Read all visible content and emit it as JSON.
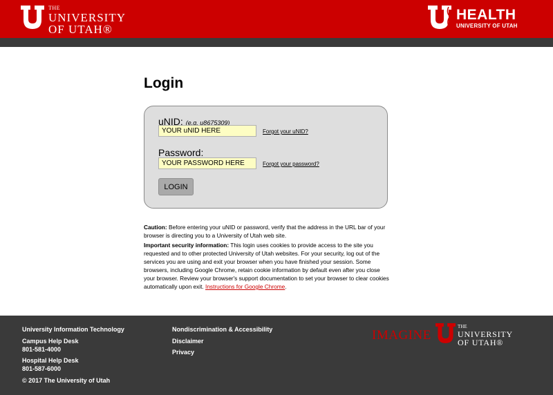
{
  "header": {
    "left_logo": {
      "the": "THE",
      "line1": "UNIVERSITY",
      "line2": "OF UTAH®"
    },
    "right_logo": {
      "title": "HEALTH",
      "subtitle": "UNIVERSITY OF UTAH"
    }
  },
  "login": {
    "title": "Login",
    "unid_label": "uNID:",
    "unid_hint": "(e.g. u8675309)",
    "unid_value": "YOUR uNID HERE",
    "forgot_unid": "Forgot your uNID?",
    "password_label": "Password:",
    "password_value": "YOUR PASSWORD HERE",
    "forgot_password": "Forgot your password?",
    "button_label": "LOGIN"
  },
  "info": {
    "caution_label": "Caution:",
    "caution_text": " Before entering your uNID or password, verify that the address in the URL bar of your browser is directing you to a University of Utah web site.",
    "security_label": "Important security information:",
    "security_text": " This login uses cookies to provide access to the site you requested and to other protected University of Utah websites. For your security, log out of the services you are using and exit your browser when you have finished your session. Some browsers, including Google Chrome, retain cookie information by default even after you close your browser. Review your browser's support documentation to set your browser to clear cookies automatically upon exit. ",
    "chrome_link": "Instructions for Google Chrome",
    "period": "."
  },
  "footer": {
    "uit": "University Information Technology",
    "campus_label": "Campus Help Desk",
    "campus_phone": "801-581-4000",
    "hospital_label": "Hospital Help Desk",
    "hospital_phone": "801-587-6000",
    "copyright": "© 2017 The University of Utah",
    "nondiscrimination": "Nondiscrimination & Accessibility",
    "disclaimer": "Disclaimer",
    "privacy": "Privacy",
    "imagine": "IMAGINE",
    "logo": {
      "the": "THE",
      "line1": "UNIVERSITY",
      "line2": "OF UTAH®"
    }
  },
  "colors": {
    "brand_red": "#cc0000",
    "dark_gray": "#3a3a3a",
    "input_yellow": "#fdfdc3"
  }
}
